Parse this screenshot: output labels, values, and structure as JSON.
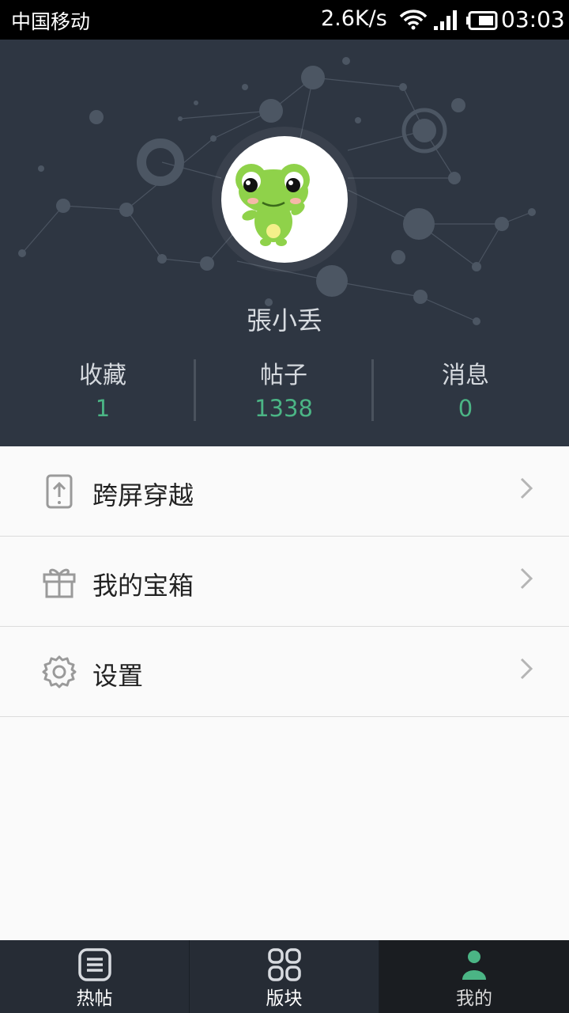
{
  "status_bar": {
    "carrier": "中国移动",
    "network_speed": "2.6K/s",
    "time": "03:03"
  },
  "profile": {
    "username": "張小丢",
    "avatar_icon": "frog-avatar",
    "stats": [
      {
        "label": "收藏",
        "value": "1"
      },
      {
        "label": "帖子",
        "value": "1338"
      },
      {
        "label": "消息",
        "value": "0"
      }
    ]
  },
  "menu": {
    "items": [
      {
        "label": "跨屏穿越",
        "icon": "phone-upload-icon"
      },
      {
        "label": "我的宝箱",
        "icon": "gift-icon"
      },
      {
        "label": "设置",
        "icon": "gear-icon"
      }
    ]
  },
  "bottom_nav": {
    "tabs": [
      {
        "label": "热帖",
        "icon": "list-icon"
      },
      {
        "label": "版块",
        "icon": "grid-icon"
      },
      {
        "label": "我的",
        "icon": "person-icon",
        "active": true
      }
    ]
  },
  "colors": {
    "header_bg": "#2e3642",
    "accent": "#4bb585",
    "nav_bg": "#262c35"
  }
}
